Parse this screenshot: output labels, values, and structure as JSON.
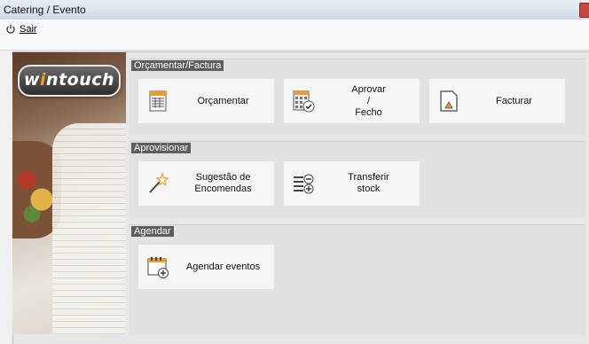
{
  "window": {
    "title": "Catering / Evento"
  },
  "menu": {
    "exit_label": "Sair"
  },
  "logo": {
    "text_before": "w",
    "text_dot": "i",
    "text_after": "ntouch"
  },
  "sections": [
    {
      "header": "Orçamentar/Factura",
      "buttons": [
        {
          "label": "Orçamentar",
          "icon": "table-icon"
        },
        {
          "label": "Aprovar\n/\nFecho",
          "icon": "calculator-check-icon"
        },
        {
          "label": "Facturar",
          "icon": "document-arrow-icon"
        }
      ]
    },
    {
      "header": "Aprovisionar",
      "buttons": [
        {
          "label": "Sugestão de\nEncomendas",
          "icon": "magic-wand-icon"
        },
        {
          "label": "Transferir\nstock",
          "icon": "list-transfer-icon"
        }
      ]
    },
    {
      "header": "Agendar",
      "buttons": [
        {
          "label": "Agendar eventos",
          "icon": "calendar-add-icon"
        }
      ]
    }
  ],
  "colors": {
    "section_header_bg": "#5d5d5d",
    "accent_orange": "#f19a2a",
    "icon_blue": "#2a6fb5"
  }
}
